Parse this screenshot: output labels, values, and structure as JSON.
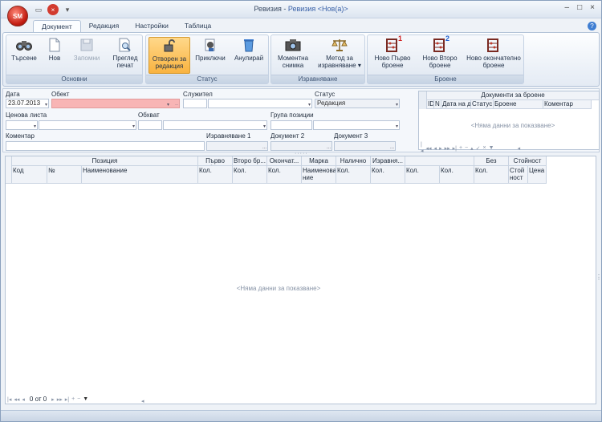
{
  "titlebar": {
    "app_logo": "SM",
    "title_app": "Ревизия",
    "title_sep": " - ",
    "title_doc": "Ревизия <Нов(а)>",
    "minimize": "–",
    "maximize": "□",
    "close": "×"
  },
  "tabs": [
    "Документ",
    "Редакция",
    "Настройки",
    "Таблица"
  ],
  "ribbon": {
    "groups": {
      "basic": "Основни",
      "status": "Статус",
      "balance": "Изравняване",
      "count": "Броене"
    },
    "buttons": {
      "search": "Търсене",
      "new": "Нов",
      "save": "Запомни",
      "preview1": "Преглед",
      "preview2": "печат",
      "open1": "Отворен за",
      "open2": "редакция",
      "finish": "Приключи",
      "cancel": "Анулирай",
      "snapshot1": "Моментна",
      "snapshot2": "снимка",
      "method1": "Метод за",
      "method2": "изравняване",
      "first1": "Ново Първо",
      "first2": "броене",
      "second1": "Ново Второ",
      "second2": "броене",
      "final1": "Ново окончателно",
      "final2": "броене",
      "badge1": "1",
      "badge2": "2"
    }
  },
  "form": {
    "date_label": "Дата",
    "date_value": "23.07.2013",
    "object_label": "Обект",
    "employee_label": "Служител",
    "status_label": "Статус",
    "status_value": "Редакция",
    "pricelist_label": "Ценова листа",
    "scope_label": "Обхват",
    "group_label": "Група позиции",
    "comment_label": "Коментар",
    "balance1_label": "Изравняване 1",
    "doc2_label": "Документ 2",
    "doc3_label": "Документ 3",
    "ellipsis": "..."
  },
  "count_docs": {
    "caption": "Документи за броене",
    "columns": [
      "ID",
      "N",
      "Дата на д",
      "Статус",
      "Броене",
      "Коментар"
    ],
    "empty": "<Няма данни за показване>"
  },
  "main_grid": {
    "band_headers": [
      "Позиция",
      "Първо бр...",
      "Второ бр...",
      "Окончат...",
      "Марка",
      "Налично",
      "Изравня...",
      "",
      "Без Изра...",
      "Стойност"
    ],
    "columns": [
      "Код",
      "№",
      "Наименование",
      "Кол.",
      "Кол.",
      "Кол.",
      "Наименова ние",
      "Кол.",
      "Кол.",
      "Кол.",
      "Кол.",
      "Кол.",
      "Стой ност",
      "Цена"
    ],
    "empty": "<Няма данни за показване>",
    "pager": "0 от 0"
  }
}
